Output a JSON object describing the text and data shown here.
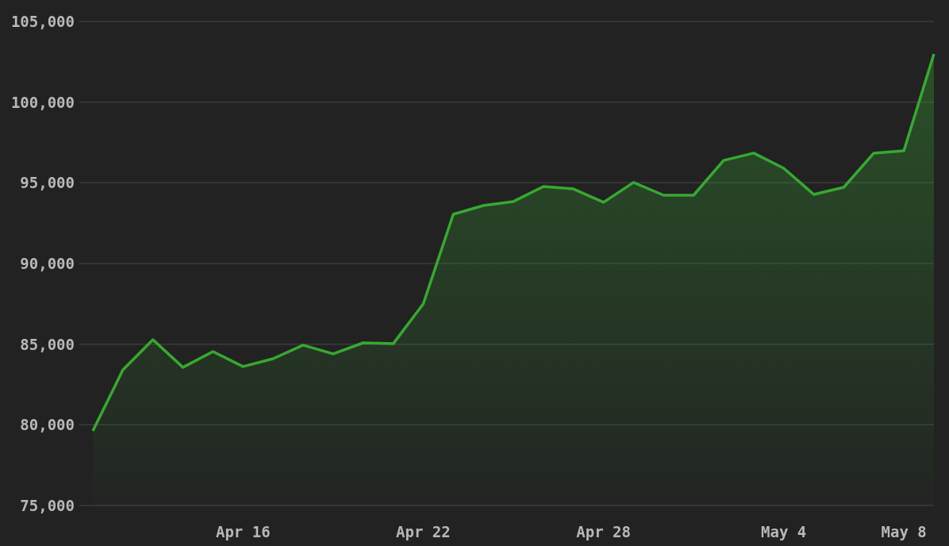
{
  "chart_data": {
    "type": "area",
    "categories": [
      null,
      null,
      null,
      null,
      null,
      "Apr 16",
      null,
      null,
      null,
      null,
      null,
      "Apr 22",
      null,
      null,
      null,
      null,
      null,
      "Apr 28",
      null,
      null,
      null,
      null,
      null,
      "May 4",
      null,
      null,
      null,
      "May 8",
      null
    ],
    "grid": true,
    "series": [
      {
        "color": "#38a832",
        "values": [
          79620,
          83410,
          85280,
          83560,
          84540,
          83610,
          84100,
          84940,
          84400,
          85080,
          85030,
          87490,
          93050,
          93590,
          93840,
          94770,
          94620,
          93790,
          95020,
          94230,
          94230,
          96390,
          96840,
          95900,
          94280,
          94720,
          96840,
          96980,
          102980
        ]
      }
    ],
    "ylim": [
      75000,
      105000
    ],
    "yticks": [
      {
        "value": 75000,
        "label": "75,000"
      },
      {
        "value": 80000,
        "label": "80,000"
      },
      {
        "value": 85000,
        "label": "85,000"
      },
      {
        "value": 90000,
        "label": "90,000"
      },
      {
        "value": 95000,
        "label": "95,000"
      },
      {
        "value": 100000,
        "label": "100,000"
      },
      {
        "value": 105000,
        "label": "105,000"
      }
    ]
  }
}
